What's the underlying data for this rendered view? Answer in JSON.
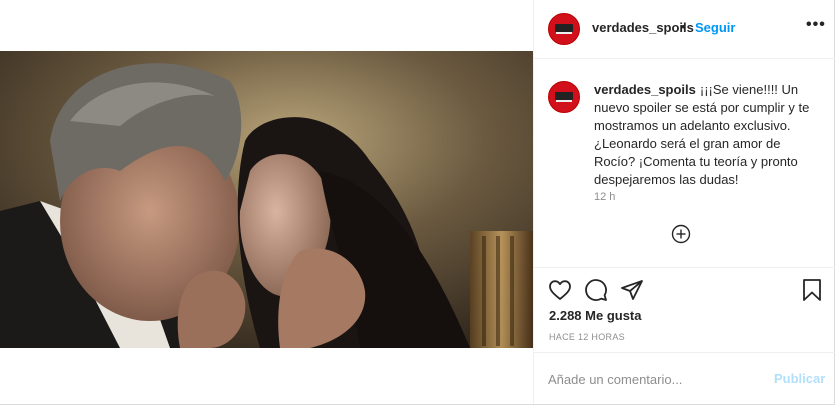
{
  "post": {
    "username": "verdades_spoils",
    "follow_label": "Seguir",
    "separator": "•",
    "more_label": "•••",
    "caption": "¡¡¡Se viene!!!! Un nuevo spoiler se está por cumplir y te mostramos un adelanto exclusivo. ¿Leonardo será el gran amor de Rocío? ¡Comenta tu teoría y pronto despejaremos las dudas!",
    "caption_time": "12 h",
    "likes": "2.288 Me gusta",
    "posted_ago": "HACE 12 HORAS",
    "comment_placeholder": "Añade un comentario...",
    "publish_label": "Publicar"
  },
  "icons": {
    "load_more": "plus-circle-icon",
    "like": "heart-icon",
    "comment": "comment-icon",
    "share": "paper-plane-icon",
    "save": "bookmark-icon"
  },
  "colors": {
    "accent": "#0095f6",
    "publish_disabled": "#b2dffc",
    "secondary_text": "#8e8e8e",
    "avatar_red": "#d1101b"
  }
}
